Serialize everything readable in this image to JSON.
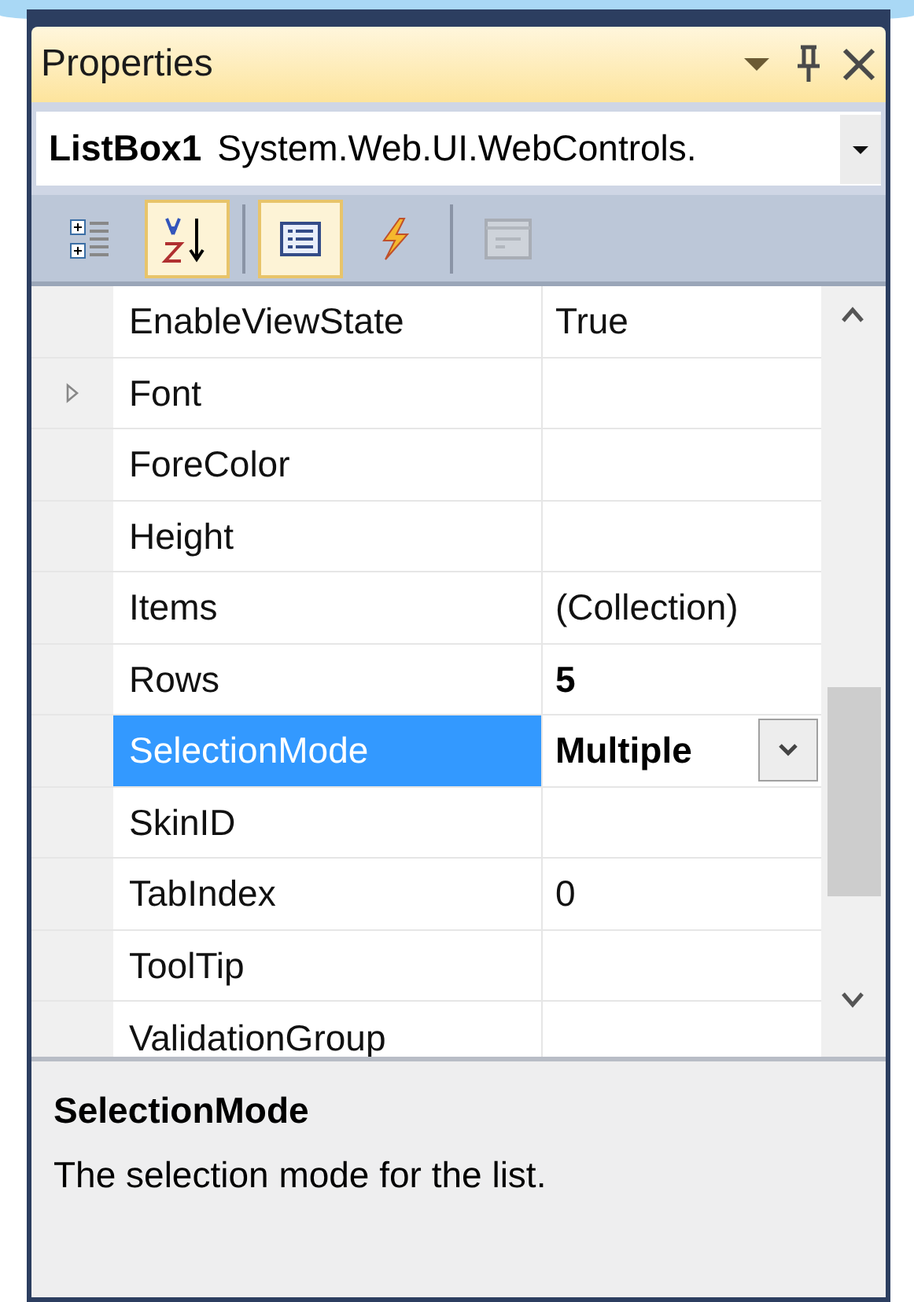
{
  "window": {
    "title": "Properties"
  },
  "object_selector": {
    "name": "ListBox1",
    "type": "System.Web.UI.WebControls."
  },
  "toolbar": [
    {
      "kind": "categorized",
      "selected": false,
      "disabled": false
    },
    {
      "kind": "alphabetical",
      "selected": true,
      "disabled": false
    },
    {
      "kind": "separator"
    },
    {
      "kind": "properties",
      "selected": true,
      "disabled": false
    },
    {
      "kind": "events",
      "selected": false,
      "disabled": false
    },
    {
      "kind": "separator"
    },
    {
      "kind": "property_pages",
      "selected": false,
      "disabled": true
    }
  ],
  "properties": [
    {
      "kind": "property",
      "name": "EnableViewState",
      "value": "True",
      "modified": false,
      "selected": false
    },
    {
      "kind": "group",
      "name": "Font",
      "selected": false,
      "expanded": false
    },
    {
      "kind": "property",
      "name": "ForeColor",
      "selected": false
    },
    {
      "kind": "property",
      "name": "Height",
      "selected": false
    },
    {
      "kind": "property",
      "name": "Items",
      "value": "(Collection)",
      "modified": false,
      "selected": false
    },
    {
      "kind": "property",
      "name": "Rows",
      "value": "5",
      "modified": true,
      "selected": false
    },
    {
      "kind": "property",
      "name": "SelectionMode",
      "value": "Multiple",
      "modified": true,
      "selected": true
    },
    {
      "kind": "property",
      "name": "SkinID",
      "selected": false
    },
    {
      "kind": "property",
      "name": "TabIndex",
      "value": "0",
      "modified": false,
      "selected": false
    },
    {
      "kind": "property",
      "name": "ToolTip",
      "selected": false
    },
    {
      "kind": "property",
      "name": "ValidationGroup",
      "selected": false
    }
  ],
  "description": {
    "title": "SelectionMode",
    "text": "The selection mode for the list."
  }
}
